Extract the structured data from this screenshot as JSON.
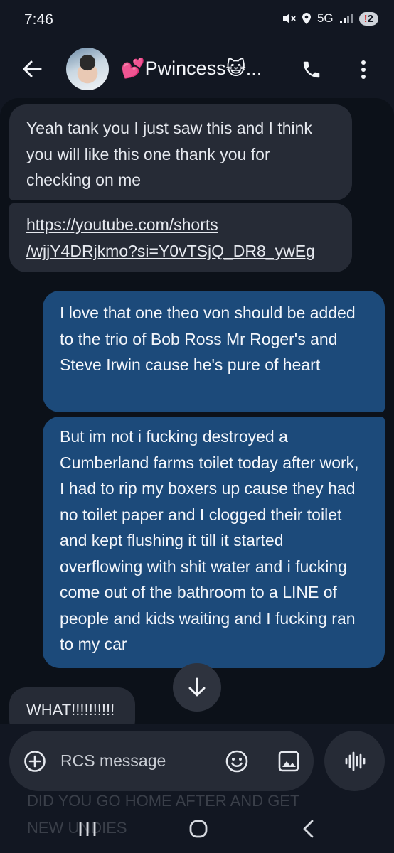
{
  "status_bar": {
    "time": "7:46",
    "network": "5G",
    "notification_count": "2",
    "notification_mark": "!",
    "icons": [
      "mute-icon",
      "location-icon",
      "signal-icon"
    ]
  },
  "header": {
    "contact_name": "💕Pwincess😺...",
    "icons": [
      "back-arrow-icon",
      "avatar",
      "phone-icon",
      "more-vert-icon"
    ]
  },
  "messages": [
    {
      "direction": "incoming",
      "text": "Yeah tank you I just saw this and I think you will like this one thank you for checking on me"
    },
    {
      "direction": "incoming",
      "link_line1": "https://youtube.com/shorts",
      "link_line2": "/wjjY4DRjkmo?si=Y0vTSjQ_DR8_ywEg"
    },
    {
      "direction": "outgoing",
      "text": "I love that one theo von should be added to the trio of Bob Ross Mr Roger's and Steve Irwin cause he's pure of heart"
    },
    {
      "direction": "outgoing",
      "text": "But im not i fucking destroyed a Cumberland farms toilet today after work, I had to rip my boxers up cause they had no toilet paper and I clogged their toilet and kept flushing it till it started overflowing with shit water and i fucking come out of the bathroom to a LINE of people and kids waiting and I fucking ran to my car"
    },
    {
      "direction": "incoming",
      "text": "WHAT!!!!!!!!!!"
    }
  ],
  "peek_text": "DID YOU GO HOME AFTER AND GET NEW UNDIES",
  "compose": {
    "placeholder": "RCS message",
    "icons": [
      "add-circle-icon",
      "emoji-icon",
      "gallery-icon",
      "voice-waveform-icon"
    ]
  },
  "nav": {
    "icons": [
      "recent-apps-icon",
      "home-icon",
      "nav-back-icon"
    ]
  },
  "colors": {
    "background": "#121722",
    "conversation_bg": "#0c1119",
    "incoming_bubble": "#262b36",
    "outgoing_bubble": "#1c4a7a",
    "badge_alert": "#d3302f"
  }
}
